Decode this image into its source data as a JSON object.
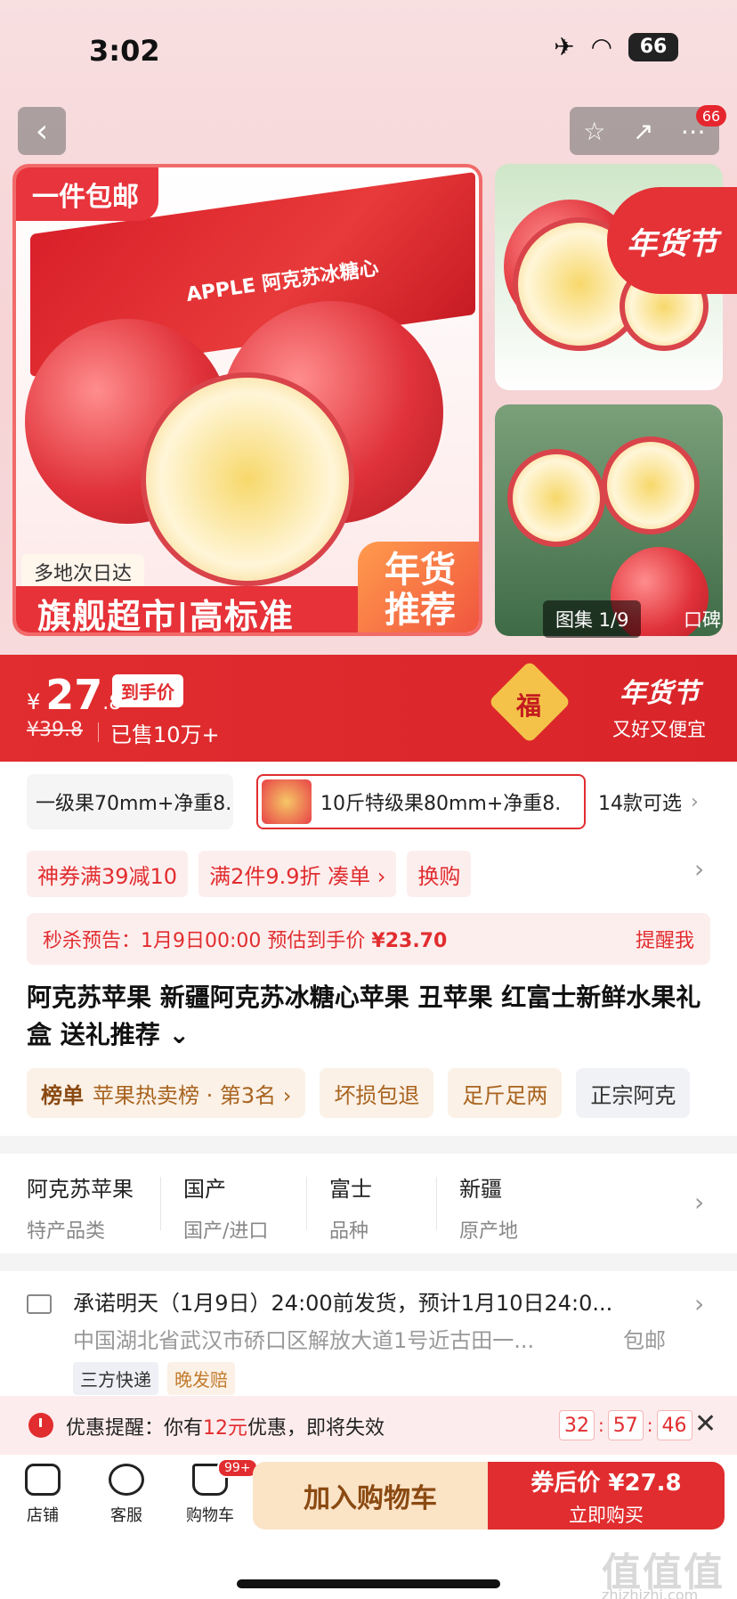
{
  "status_bar": {
    "time": "3:02",
    "battery": "66"
  },
  "header": {
    "notification_count": "66"
  },
  "hero": {
    "free_shipping": "一件包邮",
    "next_day": "多地次日达",
    "banner": "旗舰超市|高标准",
    "recommend_line1": "年货",
    "recommend_line2": "推荐",
    "box_label": "APPLE 阿克苏冰糖心",
    "festival_tag": "年货节",
    "gallery_label": "图集 1/9",
    "review_label": "口碑"
  },
  "price": {
    "currency": "¥",
    "integer": "27",
    "decimal": ".8",
    "final_label": "到手价",
    "original": "¥39.8",
    "sold": "已售10万+",
    "fu": "福",
    "festival_title": "年货节",
    "festival_sub": "又好又便宜"
  },
  "sku": {
    "item1": "一级果70mm+净重8.",
    "item2": "10斤特级果80mm+净重8.",
    "more": "14款可选"
  },
  "coupons": [
    {
      "label": "神券满39减10"
    },
    {
      "label": "满2件9.9折  凑单 ›"
    },
    {
      "label": "换购"
    }
  ],
  "flash_sale": {
    "text_prefix": "秒杀预告：1月9日00:00 预估到手价 ",
    "price": "¥23.70",
    "remind": "提醒我"
  },
  "product_title": "阿克苏苹果 新疆阿克苏冰糖心苹果 丑苹果 红富士新鲜水果礼盒 送礼推荐 ⌄",
  "tags": {
    "rank_label": "榜单",
    "rank_value": "苹果热卖榜 · 第3名 ›",
    "t2": "坏损包退",
    "t3": "足斤足两",
    "t4": "正宗阿克"
  },
  "attributes": [
    {
      "value": "阿克苏苹果",
      "key": "特产品类"
    },
    {
      "value": "国产",
      "key": "国产/进口"
    },
    {
      "value": "富士",
      "key": "品种"
    },
    {
      "value": "新疆",
      "key": "原产地"
    }
  ],
  "shipping": {
    "line1": "承诺明天（1月9日）24:00前发货，预计1月10日24:0...",
    "line2": "中国湖北省武汉市硚口区解放大道1号近古田一...",
    "free": "包邮",
    "tag1": "三方快递",
    "tag2": "晚发赔"
  },
  "reminder": {
    "prefix": "优惠提醒：你有",
    "amount": "12元",
    "suffix": "优惠，即将失效",
    "h": "32",
    "m": "57",
    "s": "46"
  },
  "bottom_bar": {
    "store": "店铺",
    "service": "客服",
    "cart": "购物车",
    "cart_badge": "99+",
    "add_to_cart": "加入购物车",
    "buy_price": "券后价 ¥27.8",
    "buy_now": "立即购买"
  },
  "watermark": {
    "text": "值值值",
    "sub": "zhizhizhi.com"
  },
  "colors": {
    "accent": "#e12d2f",
    "gold": "#f4c249",
    "cart_bg": "#fbe3c6"
  }
}
